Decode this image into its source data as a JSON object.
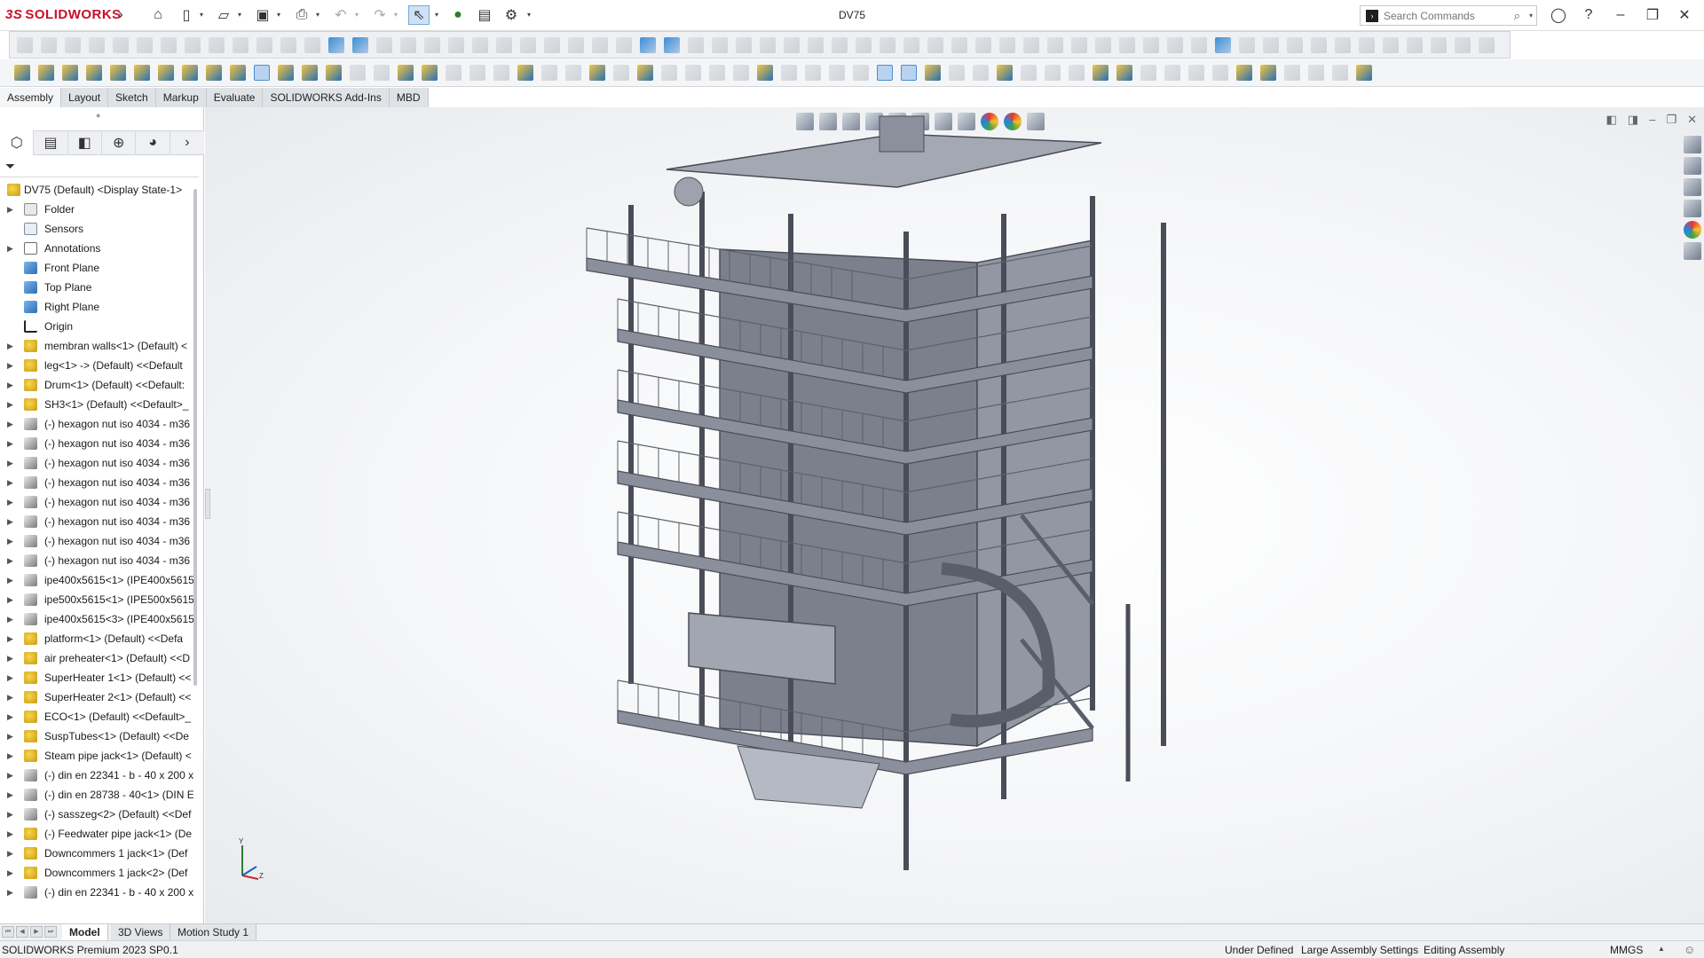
{
  "app": {
    "logo_prefix": "3S",
    "logo_text": "SOLIDWORKS",
    "document_title": "DV75"
  },
  "search": {
    "placeholder": "Search Commands"
  },
  "command_tabs": [
    {
      "label": "Assembly"
    },
    {
      "label": "Layout"
    },
    {
      "label": "Sketch"
    },
    {
      "label": "Markup"
    },
    {
      "label": "Evaluate"
    },
    {
      "label": "SOLIDWORKS Add-Ins"
    },
    {
      "label": "MBD"
    }
  ],
  "tree": {
    "root": {
      "label": "DV75 (Default) <Display State-1>",
      "icon": "assembly-icon"
    },
    "items": [
      {
        "label": "Folder",
        "icon": "folder-icon",
        "expandable": true
      },
      {
        "label": "Sensors",
        "icon": "sensor-icon",
        "expandable": false
      },
      {
        "label": "Annotations",
        "icon": "annotation-icon",
        "expandable": true
      },
      {
        "label": "Front Plane",
        "icon": "plane-icon",
        "expandable": false
      },
      {
        "label": "Top Plane",
        "icon": "plane-icon",
        "expandable": false
      },
      {
        "label": "Right Plane",
        "icon": "plane-icon",
        "expandable": false
      },
      {
        "label": "Origin",
        "icon": "origin-icon",
        "expandable": false
      },
      {
        "label": "membran walls<1> (Default) <",
        "icon": "assembly-icon",
        "expandable": true
      },
      {
        "label": "leg<1> -> (Default) <<Default",
        "icon": "assembly-icon",
        "expandable": true
      },
      {
        "label": "Drum<1> (Default) <<Default:",
        "icon": "assembly-icon",
        "expandable": true
      },
      {
        "label": "SH3<1> (Default) <<Default>_",
        "icon": "assembly-icon",
        "expandable": true
      },
      {
        "label": "(-) hexagon nut iso 4034 - m36",
        "icon": "part-icon",
        "expandable": true
      },
      {
        "label": "(-) hexagon nut iso 4034 - m36",
        "icon": "part-icon",
        "expandable": true
      },
      {
        "label": "(-) hexagon nut iso 4034 - m36",
        "icon": "part-icon",
        "expandable": true
      },
      {
        "label": "(-) hexagon nut iso 4034 - m36",
        "icon": "part-icon",
        "expandable": true
      },
      {
        "label": "(-) hexagon nut iso 4034 - m36",
        "icon": "part-icon",
        "expandable": true
      },
      {
        "label": "(-) hexagon nut iso 4034 - m36",
        "icon": "part-icon",
        "expandable": true
      },
      {
        "label": "(-) hexagon nut iso 4034 - m36",
        "icon": "part-icon",
        "expandable": true
      },
      {
        "label": "(-) hexagon nut iso 4034 - m36",
        "icon": "part-icon",
        "expandable": true
      },
      {
        "label": "ipe400x5615<1> (IPE400x5615)",
        "icon": "part-icon",
        "expandable": true
      },
      {
        "label": "ipe500x5615<1> (IPE500x5615)",
        "icon": "part-icon",
        "expandable": true
      },
      {
        "label": "ipe400x5615<3> (IPE400x5615)",
        "icon": "part-icon",
        "expandable": true
      },
      {
        "label": "platform<1> (Default) <<Defa",
        "icon": "assembly-icon",
        "expandable": true
      },
      {
        "label": "air preheater<1> (Default) <<D",
        "icon": "assembly-icon",
        "expandable": true
      },
      {
        "label": "SuperHeater 1<1> (Default) <<",
        "icon": "assembly-icon",
        "expandable": true
      },
      {
        "label": "SuperHeater 2<1> (Default) <<",
        "icon": "assembly-icon",
        "expandable": true
      },
      {
        "label": "ECO<1> (Default) <<Default>_",
        "icon": "assembly-icon",
        "expandable": true
      },
      {
        "label": "SuspTubes<1> (Default) <<De",
        "icon": "assembly-icon",
        "expandable": true
      },
      {
        "label": "Steam pipe jack<1> (Default) <",
        "icon": "assembly-icon",
        "expandable": true
      },
      {
        "label": "(-) din en 22341 - b - 40 x 200 x",
        "icon": "part-icon",
        "expandable": true
      },
      {
        "label": "(-) din en 28738 - 40<1> (DIN E",
        "icon": "part-icon",
        "expandable": true
      },
      {
        "label": "(-) sasszeg<2> (Default) <<Def",
        "icon": "part-icon",
        "expandable": true
      },
      {
        "label": "(-) Feedwater pipe jack<1> (De",
        "icon": "assembly-icon",
        "expandable": true
      },
      {
        "label": "Downcommers 1 jack<1> (Def",
        "icon": "assembly-icon",
        "expandable": true
      },
      {
        "label": "Downcommers 1 jack<2> (Def",
        "icon": "assembly-icon",
        "expandable": true
      },
      {
        "label": "(-) din en 22341 - b - 40 x 200 x",
        "icon": "part-icon",
        "expandable": true
      }
    ]
  },
  "bottom_tabs": [
    {
      "label": "Model",
      "active": true
    },
    {
      "label": "3D Views",
      "active": false
    },
    {
      "label": "Motion Study 1",
      "active": false
    }
  ],
  "status": {
    "product": "SOLIDWORKS Premium 2023 SP0.1",
    "state": "Under Defined",
    "settings": "Large Assembly Settings",
    "mode": "Editing Assembly",
    "units": "MMGS"
  },
  "triad": {
    "y_label": "Y",
    "z_label": "Z"
  },
  "colors": {
    "brand": "#c8102e",
    "model_steel": "#8b8f9c",
    "model_dark": "#4a4d57"
  }
}
